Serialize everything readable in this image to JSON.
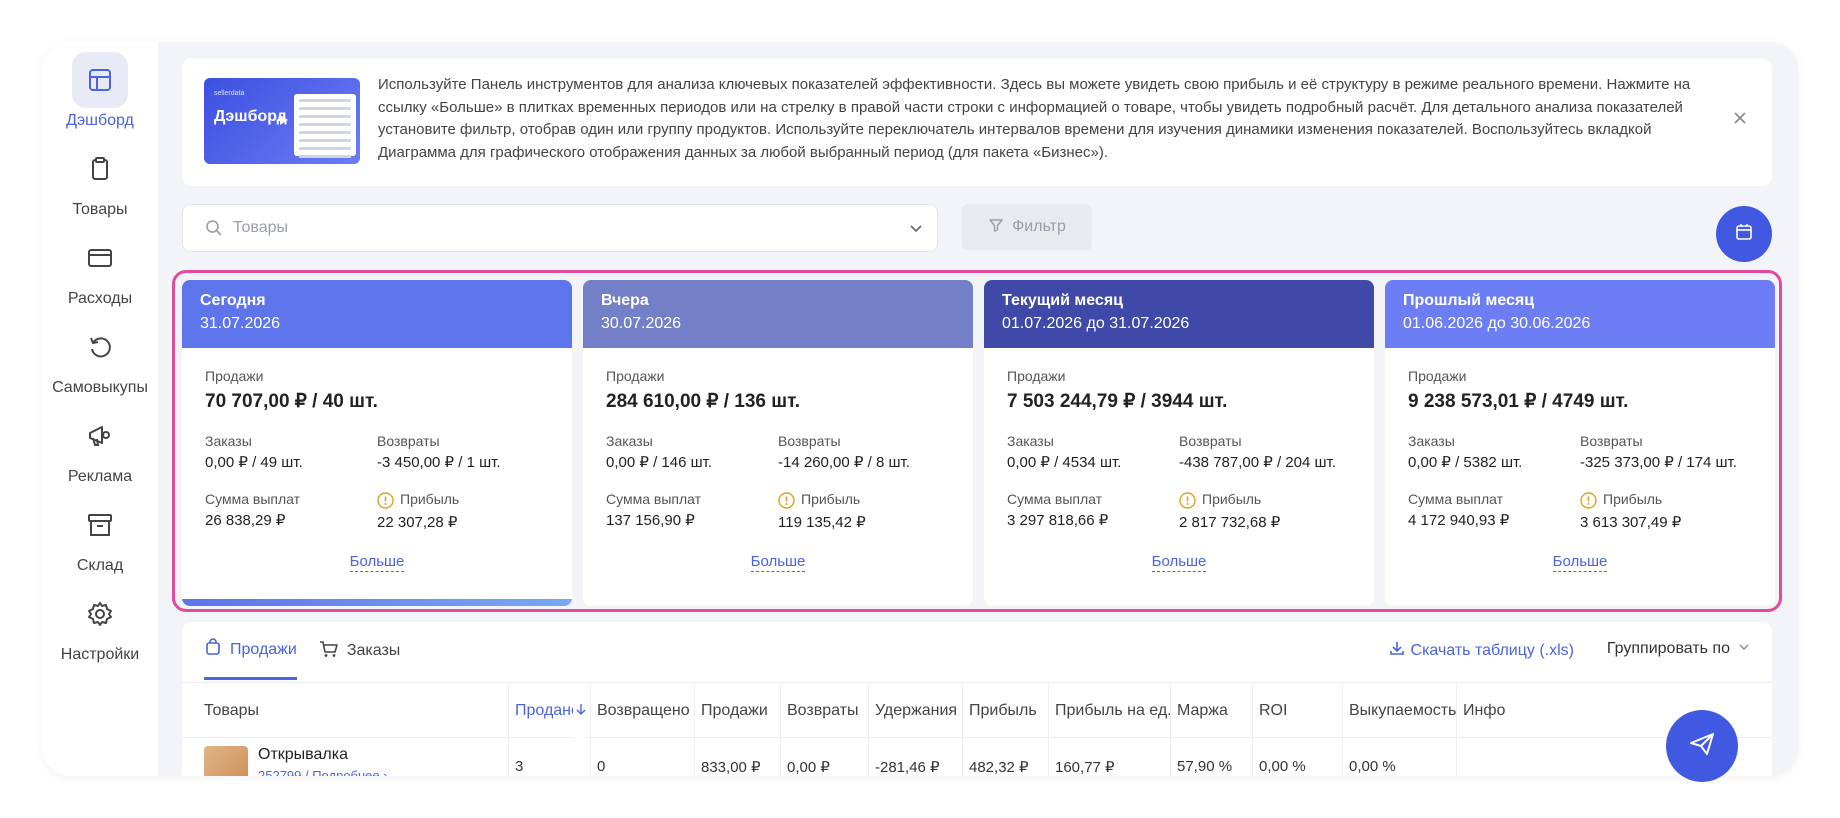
{
  "sidebar": {
    "items": [
      {
        "label": "Дэшборд",
        "icon": "dashboard-icon"
      },
      {
        "label": "Товары",
        "icon": "clipboard-icon"
      },
      {
        "label": "Расходы",
        "icon": "card-icon"
      },
      {
        "label": "Самовыкупы",
        "icon": "refresh-icon"
      },
      {
        "label": "Реклама",
        "icon": "megaphone-icon"
      },
      {
        "label": "Склад",
        "icon": "archive-icon"
      },
      {
        "label": "Настройки",
        "icon": "gear-icon"
      }
    ]
  },
  "banner": {
    "image_small": "sellerdata",
    "image_title": "Дэшборд",
    "text": "Используйте Панель инструментов для анализа ключевых показателей эффективности. Здесь вы можете увидеть свою прибыль и её структуру в режиме реального времени. Нажмите на ссылку «Больше» в плитках временных периодов или на стрелку в правой части строки с информацией о товаре, чтобы увидеть подробный расчёт. Для детального анализа показателей установите фильтр, отобрав один или группу продуктов. Используйте переключатель интервалов времени для изучения динамики изменения показателей. Воспользуйтесь вкладкой Диаграмма для графического отображения данных за любой выбранный период (для пакета «Бизнес»)."
  },
  "search": {
    "placeholder": "Товары"
  },
  "filter": {
    "label": "Фильтр"
  },
  "cards": [
    {
      "title": "Сегодня",
      "date": "31.07.2026",
      "color": "#5e74ea",
      "sales_label": "Продажи",
      "sales": "70 707,00 ₽ / 40 шт.",
      "orders_label": "Заказы",
      "orders": "0,00 ₽ / 49 шт.",
      "returns_label": "Возвраты",
      "returns": "-3 450,00 ₽ / 1 шт.",
      "payout_label": "Сумма выплат",
      "payout": "26 838,29 ₽",
      "profit_label": "Прибыль",
      "profit": "22 307,28 ₽",
      "more": "Больше"
    },
    {
      "title": "Вчера",
      "date": "30.07.2026",
      "color": "#7380c7",
      "sales_label": "Продажи",
      "sales": "284 610,00 ₽ / 136 шт.",
      "orders_label": "Заказы",
      "orders": "0,00 ₽ / 146 шт.",
      "returns_label": "Возвраты",
      "returns": "-14 260,00 ₽ / 8 шт.",
      "payout_label": "Сумма выплат",
      "payout": "137 156,90 ₽",
      "profit_label": "Прибыль",
      "profit": "119 135,42 ₽",
      "more": "Больше"
    },
    {
      "title": "Текущий месяц",
      "date": "01.07.2026 до 31.07.2026",
      "color": "#3f4aa8",
      "sales_label": "Продажи",
      "sales": "7 503 244,79 ₽ / 3944 шт.",
      "orders_label": "Заказы",
      "orders": "0,00 ₽ / 4534 шт.",
      "returns_label": "Возвраты",
      "returns": "-438 787,00 ₽ / 204 шт.",
      "payout_label": "Сумма выплат",
      "payout": "3 297 818,66 ₽",
      "profit_label": "Прибыль",
      "profit": "2 817 732,68 ₽",
      "more": "Больше"
    },
    {
      "title": "Прошлый месяц",
      "date": "01.06.2026 до 30.06.2026",
      "color": "#6d7ef5",
      "sales_label": "Продажи",
      "sales": "9 238 573,01 ₽ / 4749 шт.",
      "orders_label": "Заказы",
      "orders": "0,00 ₽ / 5382 шт.",
      "returns_label": "Возвраты",
      "returns": "-325 373,00 ₽ / 174 шт.",
      "payout_label": "Сумма выплат",
      "payout": "4 172 940,93 ₽",
      "profit_label": "Прибыль",
      "profit": "3 613 307,49 ₽",
      "more": "Больше"
    }
  ],
  "tabs": [
    {
      "label": "Продажи",
      "active": true
    },
    {
      "label": "Заказы",
      "active": false
    }
  ],
  "download": {
    "label": "Скачать таблицу (.xls)"
  },
  "group_by": {
    "label": "Группировать по"
  },
  "table": {
    "columns": [
      "Товары",
      "Продано",
      "Возвращено",
      "Продажи",
      "Возвраты",
      "Удержания",
      "Прибыль",
      "Прибыль на ед.",
      "Маржа",
      "ROI",
      "Выкупаемость",
      "Инфо"
    ],
    "rows": [
      {
        "name": "Открывалка",
        "sub": "252799 / Подробнее ›",
        "cells": [
          "3",
          "0",
          "833,00 ₽",
          "0,00 ₽",
          "-281,46 ₽",
          "482,32 ₽",
          "160,77 ₽",
          "57,90 %",
          "0,00 %",
          "0,00 %",
          ""
        ]
      }
    ]
  },
  "colors": {
    "accent": "#4a63e0",
    "highlight_outline": "#e34a9b",
    "fab": "#4158e0"
  }
}
